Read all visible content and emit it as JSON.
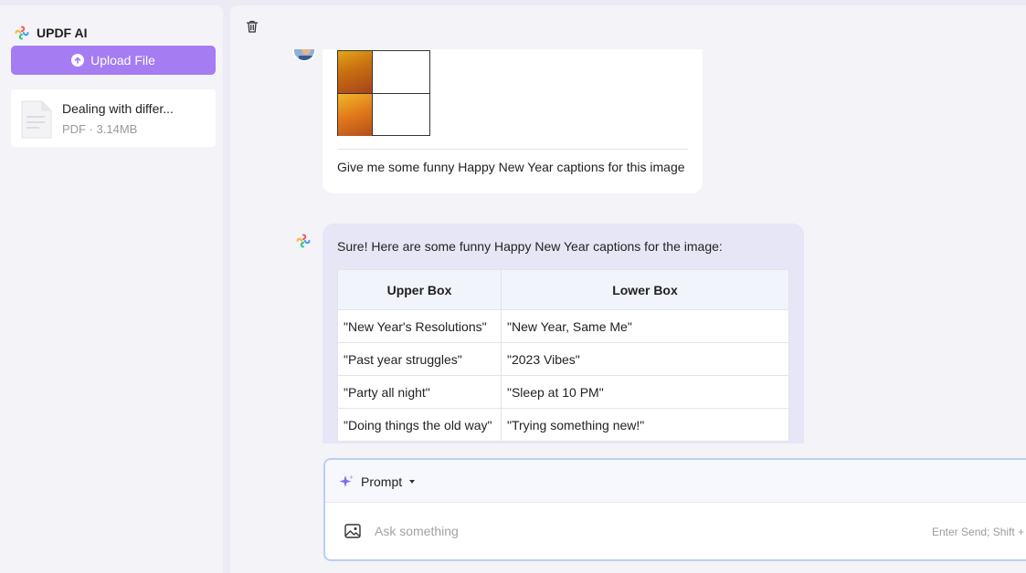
{
  "sidebar": {
    "brand_title": "UPDF AI",
    "upload_label": "Upload File",
    "file": {
      "name": "Dealing with differ...",
      "meta": "PDF · 3.14MB"
    }
  },
  "chat": {
    "user_message": "Give me some funny Happy New Year captions for this image",
    "ai_intro": "Sure! Here are some funny Happy New Year captions for the image:",
    "table": {
      "headers": [
        "Upper Box",
        "Lower Box"
      ],
      "rows": [
        [
          "\"New Year's Resolutions\"",
          "\"New Year, Same Me\""
        ],
        [
          "\"Past year struggles\"",
          "\"2023 Vibes\""
        ],
        [
          "\"Party all night\"",
          "\"Sleep at 10 PM\""
        ],
        [
          "\"Doing things the old way\"",
          "\"Trying something new!\""
        ]
      ]
    }
  },
  "composer": {
    "prompt_label": "Prompt",
    "input_placeholder": "Ask something",
    "hint": "Enter Send; Shift +"
  },
  "colors": {
    "accent": "#a57cf2",
    "ai_bubble": "#e7e6f6",
    "composer_border": "#b8d0f2"
  },
  "icons": [
    "updf-logo-icon",
    "upload-icon",
    "pdf-file-icon",
    "trash-icon",
    "user-avatar",
    "ai-logo-icon",
    "sparkle-icon",
    "dropdown-caret-icon",
    "image-icon"
  ]
}
